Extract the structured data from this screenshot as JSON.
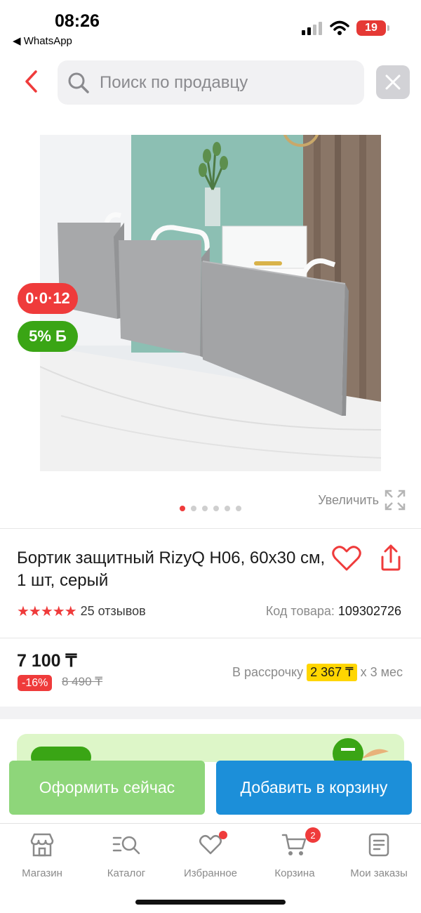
{
  "status_bar": {
    "time": "08:26",
    "back_app": "◀ WhatsApp",
    "battery": "19"
  },
  "search": {
    "placeholder": "Поиск по продавцу",
    "back_icon": "chevron-left-icon",
    "clear_icon": "close-icon"
  },
  "product": {
    "badges": {
      "installment": "0·0·12",
      "bonus": "5% Б"
    },
    "zoom_label": "Увеличить",
    "images_count": 6,
    "active_image": 1,
    "title": "Бортик защитный RizyQ H06, 60x30 см, 1 шт, серый",
    "rating_stars": "★★★★★",
    "rating_value": 5,
    "reviews": "25 отзывов",
    "sku_label": "Код товара:",
    "sku_value": "109302726"
  },
  "price": {
    "current": "7 100 ₸",
    "discount": "-16%",
    "old": "8 490 ₸",
    "installment_prefix": "В рассрочку",
    "installment_amount": "2 367 ₸",
    "installment_suffix": "х 3 мес"
  },
  "actions": {
    "checkout": "Оформить сейчас",
    "add_to_cart": "Добавить в корзину"
  },
  "tabs": [
    {
      "label": "Магазин",
      "icon": "store-icon"
    },
    {
      "label": "Каталог",
      "icon": "catalog-search-icon"
    },
    {
      "label": "Избранное",
      "icon": "heart-icon",
      "dot": true
    },
    {
      "label": "Корзина",
      "icon": "cart-icon",
      "badge": "2"
    },
    {
      "label": "Мои заказы",
      "icon": "orders-icon"
    }
  ],
  "colors": {
    "accent_red": "#ef3b3b",
    "bonus_green": "#3aa515",
    "checkout_green": "#8ed67a",
    "cart_blue": "#1c8fd9",
    "installment_yellow": "#ffd600"
  }
}
